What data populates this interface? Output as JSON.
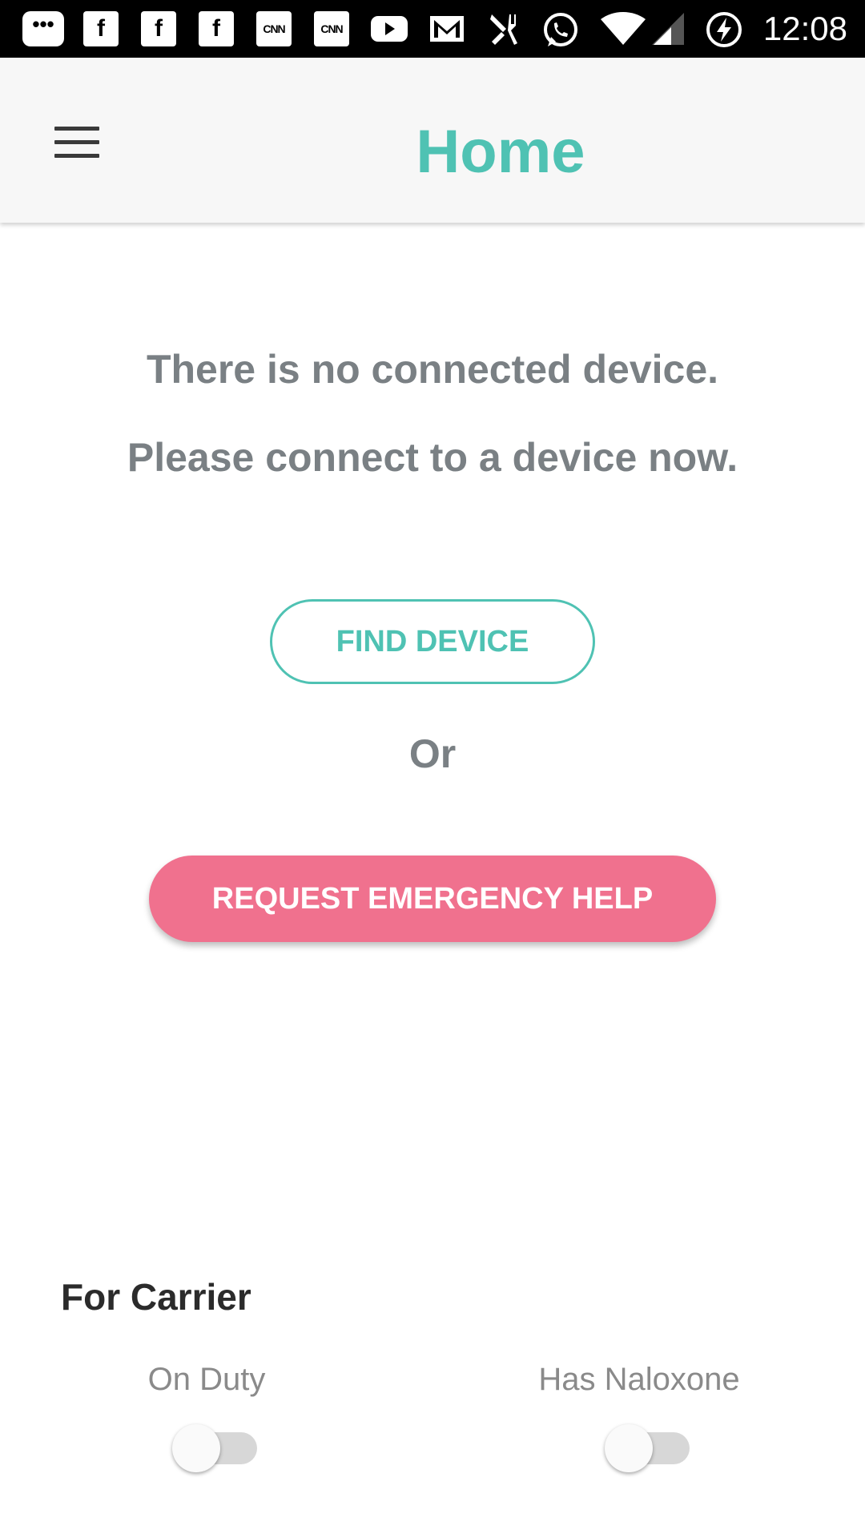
{
  "status_bar": {
    "time": "12:08",
    "icons": [
      "messenger-icon",
      "facebook-icon",
      "facebook-icon",
      "facebook-icon",
      "cnn-icon",
      "cnn-icon",
      "youtube-icon",
      "gmail-icon",
      "food-delivery-icon",
      "whatsapp-icon",
      "wifi-icon",
      "signal-icon",
      "battery-charging-icon"
    ],
    "cnn_label": "CNN"
  },
  "app_bar": {
    "title": "Home",
    "menu_icon": "hamburger-menu-icon"
  },
  "main": {
    "message_line1": "There is no connected device.",
    "message_line2": "Please connect to a device now.",
    "find_device_label": "FIND DEVICE",
    "or_label": "Or",
    "emergency_label": "REQUEST EMERGENCY HELP"
  },
  "carrier": {
    "title": "For Carrier",
    "on_duty_label": "On Duty",
    "on_duty_value": false,
    "naloxone_label": "Has Naloxone",
    "naloxone_value": false
  },
  "colors": {
    "accent": "#4fc2b3",
    "emergency": "#f0718e",
    "text_muted": "#7a8084"
  }
}
